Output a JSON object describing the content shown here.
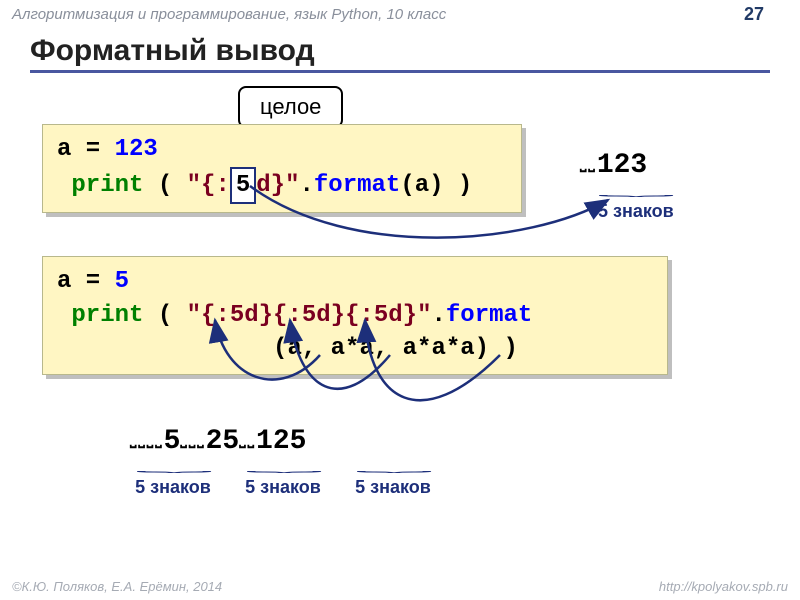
{
  "header": "Алгоритмизация и программирование, язык Python, 10 класс",
  "page": "27",
  "title": "Форматный вывод",
  "callout": "целое",
  "code1": {
    "l1_a": "a = ",
    "l1_b": "123",
    "l2_a": "print",
    "l2_b": " ( ",
    "l2_c": "\"{:",
    "l2_hl": "5",
    "l2_d": "d}\"",
    "l2_e": ".",
    "l2_f": "format",
    "l2_g": "(a) )"
  },
  "out1": {
    "val": "123",
    "pads": "⎵⎵",
    "label": "5 знаков"
  },
  "code2": {
    "l1_a": "a = ",
    "l1_b": "5",
    "l2_a": "print",
    "l2_b": " ( ",
    "l2_c": "\"{:5d}{:5d}{:5d}\"",
    "l2_d": ".",
    "l2_e": "format",
    "l3": "               (a, a*a, a*a*a) )"
  },
  "out2": {
    "p1": "⎵⎵⎵⎵",
    "v1": "5",
    "p2": "⎵⎵⎵",
    "v2": "25",
    "p3": "⎵⎵",
    "v3": "125",
    "lab1": "5 знаков",
    "lab2": "5 знаков",
    "lab3": "5 знаков"
  },
  "footer_left": "©К.Ю. Поляков, Е.А. Ерёмин, 2014",
  "footer_right": "http://kpolyakov.spb.ru"
}
